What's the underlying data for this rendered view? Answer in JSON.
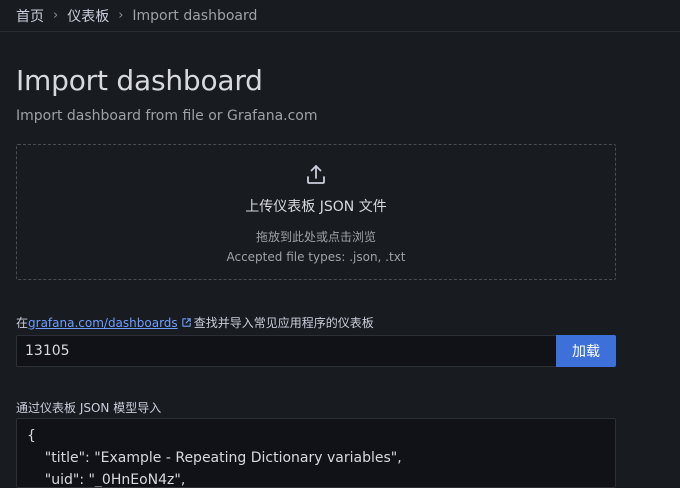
{
  "breadcrumb": {
    "items": [
      "首页",
      "仪表板"
    ],
    "current": "Import dashboard",
    "separator": "›"
  },
  "page": {
    "title": "Import dashboard",
    "subtitle": "Import dashboard from file or Grafana.com"
  },
  "dropzone": {
    "icon": "upload-icon",
    "title": "上传仪表板 JSON 文件",
    "hint": "拖放到此处或点击浏览",
    "accepted_types": "Accepted file types: .json, .txt"
  },
  "grafana_com": {
    "prefix": "在",
    "link_text": "grafana.com/dashboards",
    "link_icon": "external-link-icon",
    "suffix": "查找并导入常见应用程序的仪表板",
    "input_value": "13105",
    "load_label": "加载"
  },
  "json_model": {
    "label": "通过仪表板 JSON 模型导入",
    "lines": [
      "{",
      "    \"title\": \"Example - Repeating Dictionary variables\",",
      "    \"uid\": \"_0HnEoN4z\","
    ]
  },
  "colors": {
    "background": "#181b1f",
    "primary_button": "#3d71d9",
    "link": "#6e9fff"
  }
}
